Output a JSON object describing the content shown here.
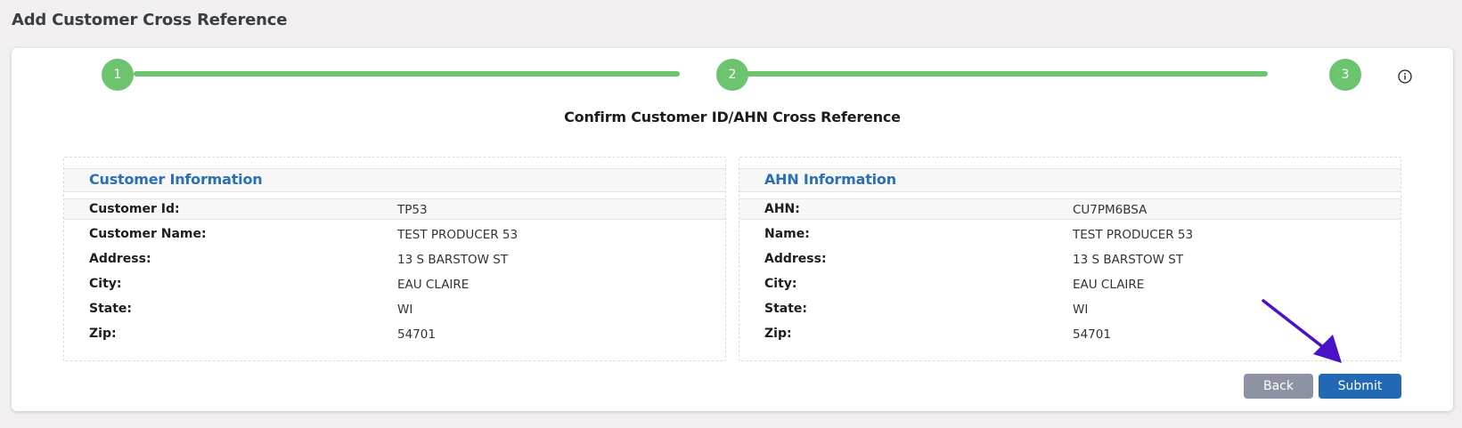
{
  "page": {
    "title": "Add Customer Cross Reference"
  },
  "stepper": {
    "steps": [
      "1",
      "2",
      "3"
    ],
    "color": "#6cc46f"
  },
  "confirm": {
    "subtitle": "Confirm Customer ID/AHN Cross Reference"
  },
  "customer_panel": {
    "title": "Customer Information",
    "rows": [
      {
        "label": "Customer Id:",
        "value": "TP53"
      },
      {
        "label": "Customer Name:",
        "value": "TEST PRODUCER 53"
      },
      {
        "label": "Address:",
        "value": "13 S BARSTOW ST"
      },
      {
        "label": "City:",
        "value": "EAU CLAIRE"
      },
      {
        "label": "State:",
        "value": "WI"
      },
      {
        "label": "Zip:",
        "value": "54701"
      }
    ]
  },
  "ahn_panel": {
    "title": "AHN Information",
    "rows": [
      {
        "label": "AHN:",
        "value": "CU7PM6BSA"
      },
      {
        "label": "Name:",
        "value": "TEST PRODUCER 53"
      },
      {
        "label": "Address:",
        "value": "13 S BARSTOW ST"
      },
      {
        "label": "City:",
        "value": "EAU CLAIRE"
      },
      {
        "label": "State:",
        "value": "WI"
      },
      {
        "label": "Zip:",
        "value": "54701"
      }
    ]
  },
  "actions": {
    "back_label": "Back",
    "submit_label": "Submit",
    "back_color": "#8d93a3",
    "submit_color": "#2268b2"
  },
  "icons": {
    "info": "info-icon",
    "annotation": "annotation-arrow-icon"
  },
  "colors": {
    "accent": "#2a70b5",
    "annotation_arrow": "#4a12c8"
  }
}
